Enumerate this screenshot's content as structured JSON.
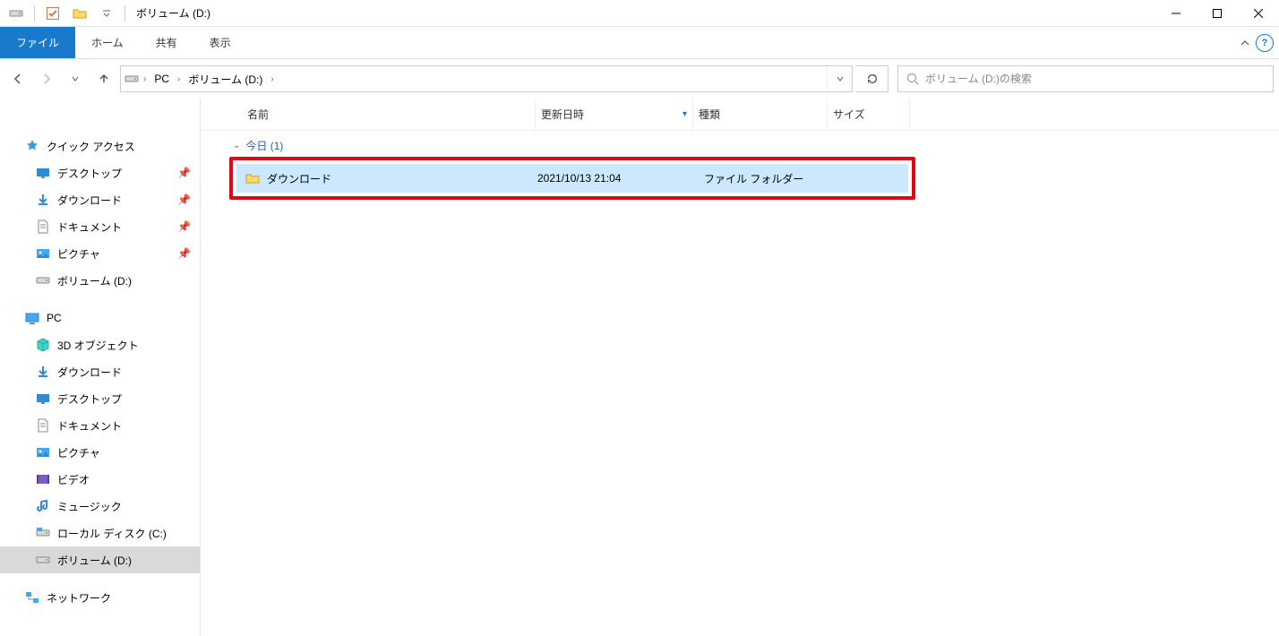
{
  "window": {
    "title": "ボリューム (D:)"
  },
  "ribbon": {
    "file": "ファイル",
    "home": "ホーム",
    "share": "共有",
    "view": "表示"
  },
  "breadcrumb": {
    "pc": "PC",
    "vol": "ボリューム (D:)"
  },
  "search": {
    "placeholder": "ボリューム (D:)の検索"
  },
  "columns": {
    "name": "名前",
    "date": "更新日時",
    "type": "種類",
    "size": "サイズ"
  },
  "group": {
    "header": "今日 (1)"
  },
  "item": {
    "name": "ダウンロード",
    "date": "2021/10/13 21:04",
    "type": "ファイル フォルダー"
  },
  "tree": {
    "quick": "クイック アクセス",
    "desktop": "デスクトップ",
    "downloads": "ダウンロード",
    "documents": "ドキュメント",
    "pictures": "ピクチャ",
    "volumeD_q": "ボリューム (D:)",
    "pc": "PC",
    "objects3d": "3D オブジェクト",
    "downloads2": "ダウンロード",
    "desktop2": "デスクトップ",
    "documents2": "ドキュメント",
    "pictures2": "ピクチャ",
    "videos": "ビデオ",
    "music": "ミュージック",
    "localC": "ローカル ディスク (C:)",
    "volumeD": "ボリューム (D:)",
    "network": "ネットワーク"
  }
}
